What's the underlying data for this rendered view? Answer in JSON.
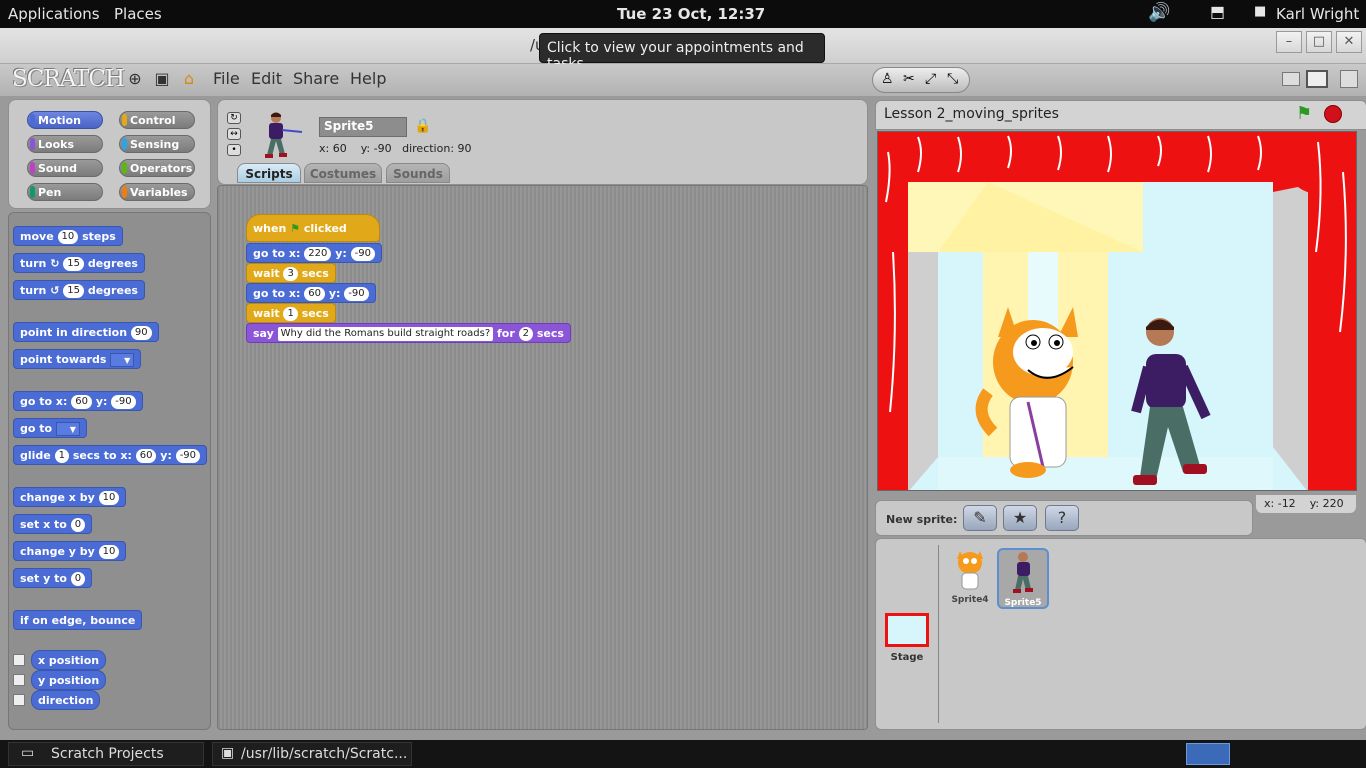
{
  "topbar": {
    "applications": "Applications",
    "places": "Places",
    "clock": "Tue 23 Oct, 12:37",
    "user": "Karl Wright"
  },
  "window": {
    "title_fragment": "/u",
    "tooltip": "Click to view your appointments and tasks",
    "minimize": "–",
    "maximize": "□",
    "close": "✕"
  },
  "scratch": {
    "logo": "SCRATCH",
    "menu": {
      "file": "File",
      "edit": "Edit",
      "share": "Share",
      "help": "Help"
    }
  },
  "categories": [
    {
      "label": "Motion",
      "color": "#4a6cd4",
      "selected": true
    },
    {
      "label": "Control",
      "color": "#e1a91a"
    },
    {
      "label": "Looks",
      "color": "#8a55d7"
    },
    {
      "label": "Sensing",
      "color": "#2ca5e2"
    },
    {
      "label": "Sound",
      "color": "#bb42c3"
    },
    {
      "label": "Operators",
      "color": "#5cb712"
    },
    {
      "label": "Pen",
      "color": "#0e9a6c"
    },
    {
      "label": "Variables",
      "color": "#ee7d16"
    }
  ],
  "palette": {
    "move": "move",
    "move_n": "10",
    "steps": "steps",
    "turn": "turn",
    "turn_cw_n": "15",
    "degrees": "degrees",
    "turn_ccw_n": "15",
    "point_dir": "point in direction",
    "point_dir_n": "90",
    "point_towards": "point towards",
    "goto_xy": "go to x:",
    "goto_x": "60",
    "y": "y:",
    "goto_y": "-90",
    "goto": "go to",
    "glide": "glide",
    "glide_n": "1",
    "glide_secs": "secs to x:",
    "glide_x": "60",
    "glide_y": "-90",
    "change_x": "change x by",
    "change_x_n": "10",
    "set_x": "set x to",
    "set_x_n": "0",
    "change_y": "change y by",
    "change_y_n": "10",
    "set_y": "set y to",
    "set_y_n": "0",
    "bounce": "if on edge, bounce",
    "x_position": "x position",
    "y_position": "y position",
    "direction": "direction"
  },
  "sprite": {
    "name": "Sprite5",
    "x_label": "x:",
    "x": "60",
    "y_label": "y:",
    "y": "-90",
    "dir_label": "direction:",
    "dir": "90"
  },
  "tabs": {
    "scripts": "Scripts",
    "costumes": "Costumes",
    "sounds": "Sounds"
  },
  "script": {
    "when": "when",
    "clicked": "clicked",
    "goto1": "go to x:",
    "goto1_x": "220",
    "y": "y:",
    "goto1_y": "-90",
    "wait": "wait",
    "wait1_n": "3",
    "secs": "secs",
    "goto2": "go to x:",
    "goto2_x": "60",
    "goto2_y": "-90",
    "wait2_n": "1",
    "say": "say",
    "say_text": "Why did the Romans build straight roads?",
    "for": "for",
    "say_n": "2"
  },
  "stage": {
    "title": "Lesson 2_moving_sprites",
    "mouse_x_label": "x:",
    "mouse_x": "-12",
    "mouse_y_label": "y:",
    "mouse_y": "220",
    "new_sprite": "New sprite:"
  },
  "sprites": [
    {
      "name": "Sprite4"
    },
    {
      "name": "Sprite5",
      "selected": true
    }
  ],
  "stage_item": "Stage",
  "taskbar": {
    "item1": "Scratch Projects",
    "item2": "/usr/lib/scratch/Scratc..."
  }
}
